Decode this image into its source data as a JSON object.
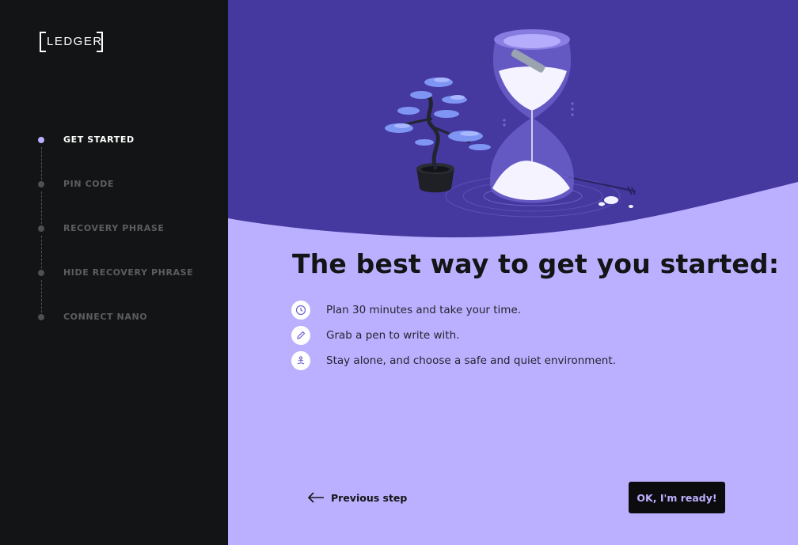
{
  "app": {
    "logo_text": "LEDGER"
  },
  "sidebar": {
    "steps": [
      {
        "label": "GET STARTED",
        "state": "active"
      },
      {
        "label": "PIN CODE",
        "state": "inactive"
      },
      {
        "label": "RECOVERY PHRASE",
        "state": "inactive"
      },
      {
        "label": "HIDE RECOVERY PHRASE",
        "state": "inactive"
      },
      {
        "label": "CONNECT NANO",
        "state": "inactive"
      }
    ]
  },
  "main": {
    "title": "The best way to get you started:",
    "tips": [
      {
        "icon": "clock-icon",
        "text": "Plan 30 minutes and take your time."
      },
      {
        "icon": "pen-icon",
        "text": "Grab a pen to write with."
      },
      {
        "icon": "meditation-icon",
        "text": "Stay alone, and choose a safe and quiet environment."
      }
    ],
    "previous_label": "Previous step",
    "confirm_label": "OK, I'm ready!"
  },
  "colors": {
    "sidebar_bg": "#131415",
    "hero_bg": "#4539a0",
    "main_bg": "#bbb0ff",
    "accent": "#bbb0ff",
    "button_bg": "#0c0c0f"
  }
}
